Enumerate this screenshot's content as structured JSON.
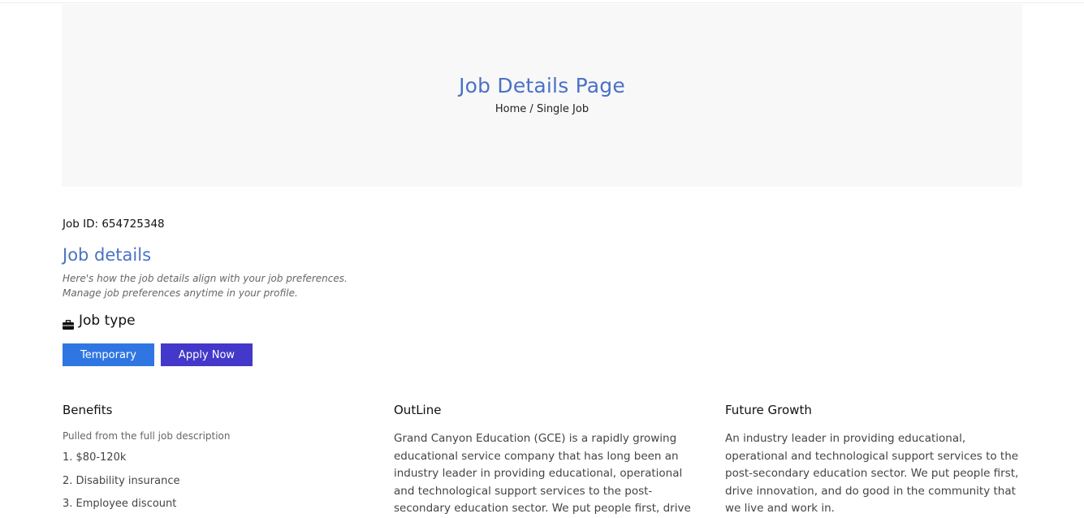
{
  "hero": {
    "title": "Job Details Page",
    "breadcrumb_home": "Home",
    "breadcrumb_sep": " / ",
    "breadcrumb_current": "Single Job"
  },
  "job": {
    "id_label": "Job ID: 654725348",
    "section_title": "Job details",
    "section_desc": "Here's how the job details align with your job preferences. Manage job preferences anytime in your profile.",
    "type_label": "Job type",
    "type_icon": "briefcase-icon",
    "temporary_label": "Temporary",
    "apply_label": "Apply Now"
  },
  "benefits": {
    "title": "Benefits",
    "subtitle": "Pulled from the full job description",
    "items": [
      "1. $80-120k",
      "2. Disability insurance",
      "3. Employee discount"
    ]
  },
  "outline": {
    "title": "OutLine",
    "text": "Grand Canyon Education (GCE) is a rapidly growing educational service company that has long been an industry leader in providing educational, operational and technological support services to the post-secondary education sector. We put people first, drive"
  },
  "growth": {
    "title": "Future Growth",
    "text": "An industry leader in providing educational, operational and technological support services to the post-secondary education sector. We put people first, drive innovation, and do good in the community that we live and work in."
  },
  "colors": {
    "accent": "#4a72c4",
    "temporary_button": "#2f76e3",
    "apply_button": "#4338c9"
  }
}
